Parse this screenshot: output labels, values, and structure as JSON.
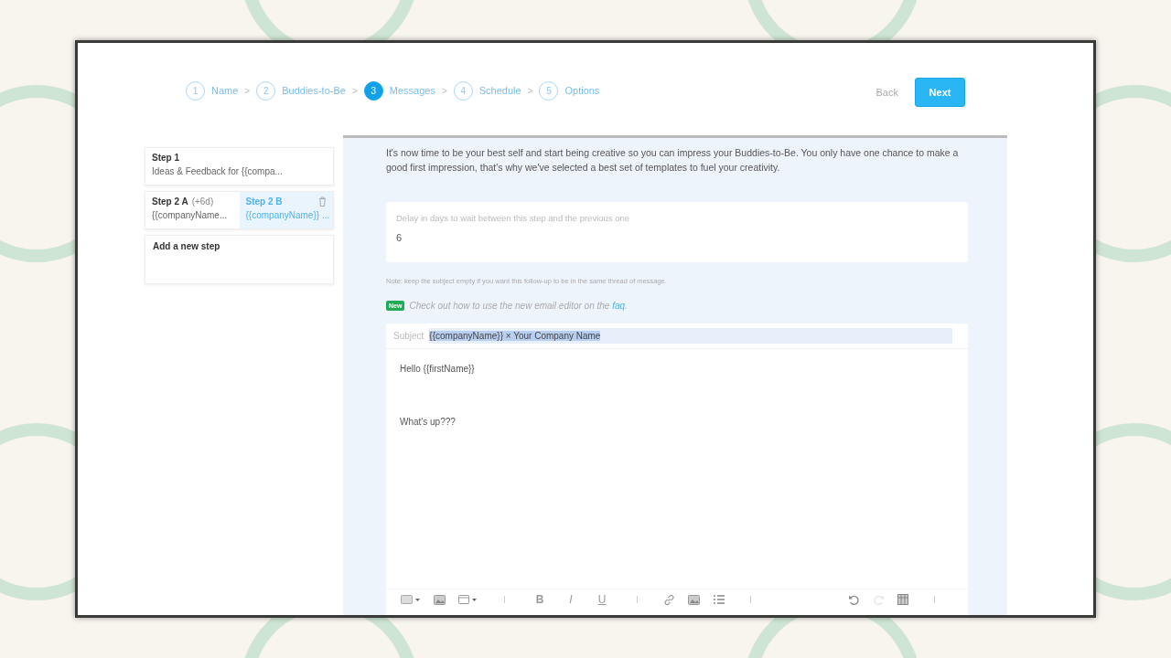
{
  "stepper": {
    "steps": [
      {
        "number": "1",
        "label": "Name",
        "selected": false
      },
      {
        "number": "2",
        "label": "Buddies-to-Be",
        "selected": false
      },
      {
        "number": "3",
        "label": "Messages",
        "selected": true
      },
      {
        "number": "4",
        "label": "Schedule",
        "selected": false
      },
      {
        "number": "5",
        "label": "Options",
        "selected": false
      }
    ],
    "separator": ">"
  },
  "actions": {
    "back": "Back",
    "next": "Next"
  },
  "sidebar": {
    "steps": [
      {
        "variants": [
          {
            "title": "Step 1",
            "subtitle": "Ideas & Feedback for {{compa...",
            "selected": false
          }
        ]
      },
      {
        "variants": [
          {
            "title": "Step 2 A",
            "delay": "(+6d)",
            "subtitle": "{{companyName...",
            "selected": false
          },
          {
            "title": "Step 2 B",
            "subtitle": "{{companyName}} ...",
            "selected": true
          }
        ]
      }
    ],
    "add_step": "Add a new step"
  },
  "intro": "It's now time to be your best self and start being creative so you can impress your Buddies-to-Be. You only have one chance to make a good first impression, that's why we've selected a best set of templates to fuel your creativity.",
  "delay_field": {
    "label": "Delay in days to wait between this step and the previous one",
    "value": "6"
  },
  "note": "Note: keep the subject empty if you want this follow-up to be in the same thread of message.",
  "tip": {
    "badge": "New",
    "text": "Check out how to use the new email editor on the",
    "link": "faq",
    "end": "."
  },
  "editor": {
    "subject_label": "Subject",
    "subject": "{{companyName}} × Your Company Name",
    "body": [
      "Hello {{firstName}}",
      "What's up???"
    ],
    "format_buttons": [
      "B",
      "I",
      "U"
    ]
  }
}
